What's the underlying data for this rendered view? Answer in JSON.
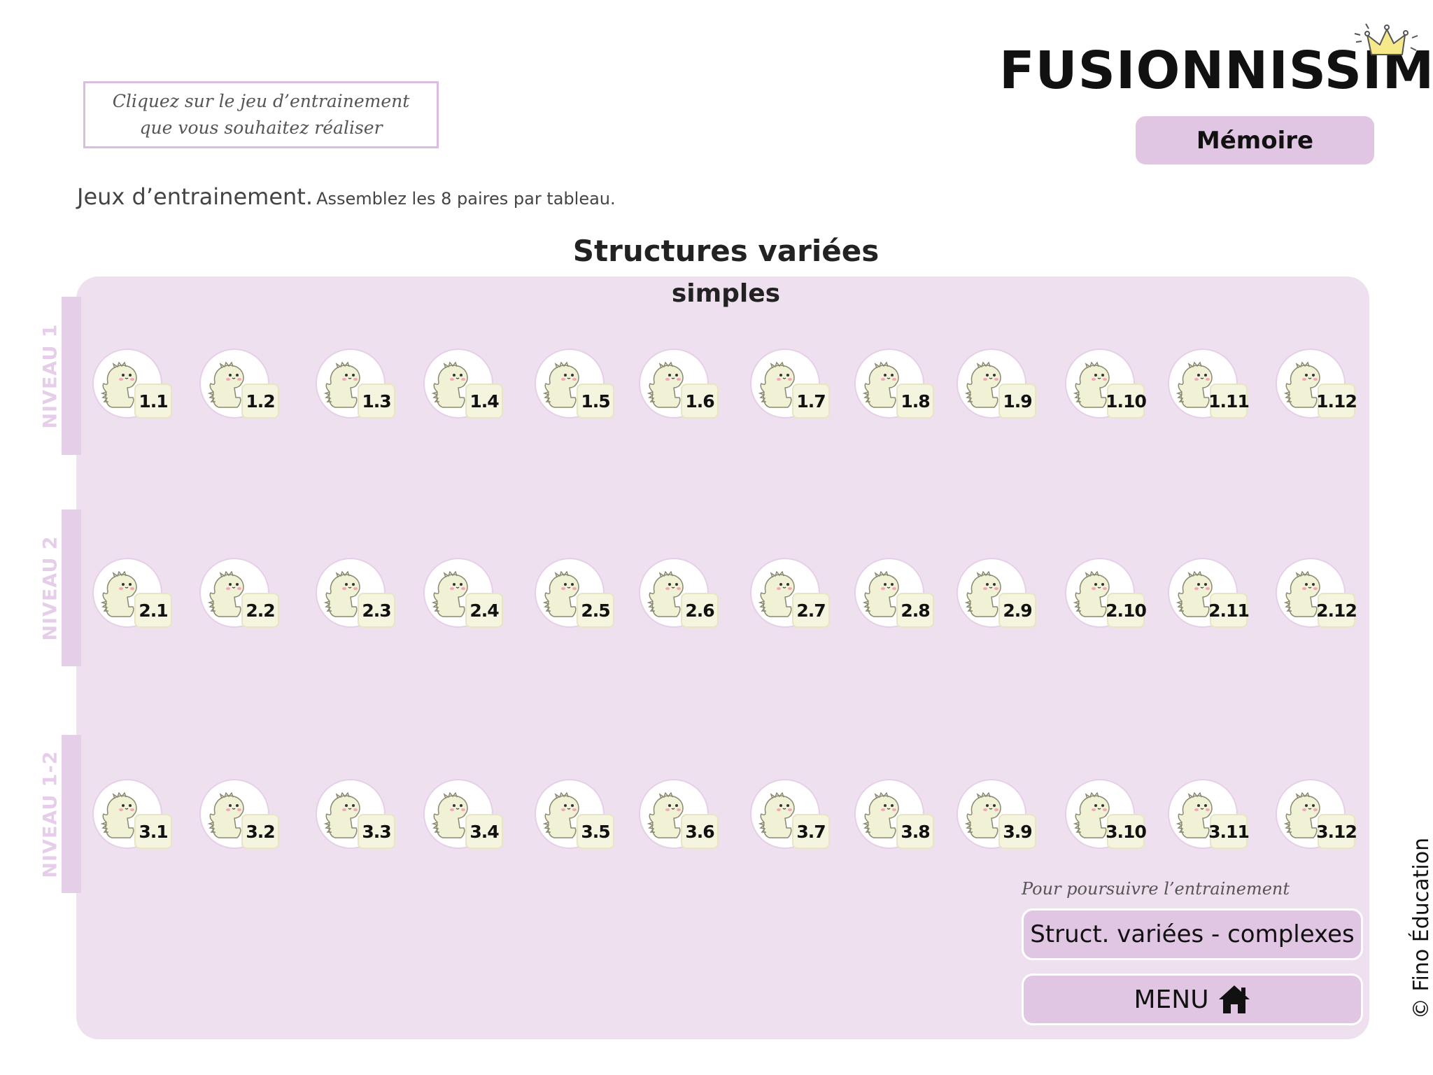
{
  "hint": {
    "line1": "Cliquez sur le jeu d’entrainement",
    "line2": "que vous souhaitez réaliser"
  },
  "logo": {
    "text": "FUSIONNISSIMO"
  },
  "mode_button": {
    "label": "Mémoire"
  },
  "instructions": {
    "heading": "Jeux d’entrainement.",
    "detail": "Assemblez les 8 paires par tableau."
  },
  "title": "Structures variées",
  "subtitle": "simples",
  "levels": [
    {
      "label": "NIVEAU 1",
      "games": [
        "1.1",
        "1.2",
        "1.3",
        "1.4",
        "1.5",
        "1.6",
        "1.7",
        "1.8",
        "1.9",
        "1.10",
        "1.11",
        "1.12"
      ]
    },
    {
      "label": "NIVEAU 2",
      "games": [
        "2.1",
        "2.2",
        "2.3",
        "2.4",
        "2.5",
        "2.6",
        "2.7",
        "2.8",
        "2.9",
        "2.10",
        "2.11",
        "2.12"
      ]
    },
    {
      "label": "NIVEAU 1-2",
      "games": [
        "3.1",
        "3.2",
        "3.3",
        "3.4",
        "3.5",
        "3.6",
        "3.7",
        "3.8",
        "3.9",
        "3.10",
        "3.11",
        "3.12"
      ]
    }
  ],
  "continue": {
    "label": "Pour poursuivre l’entrainement",
    "next_button": "Struct. variées - complexes",
    "menu_button": "MENU"
  },
  "icons": {
    "game": "dinosaur-icon",
    "menu": "home-icon",
    "logo_decoration": "crown-icon"
  },
  "colors": {
    "panel": "#eee0ee",
    "button": "#e0c6e3",
    "tab": "#e5cfe8",
    "badge": "#f5f4df"
  },
  "copyright": "© Fino Éducation"
}
